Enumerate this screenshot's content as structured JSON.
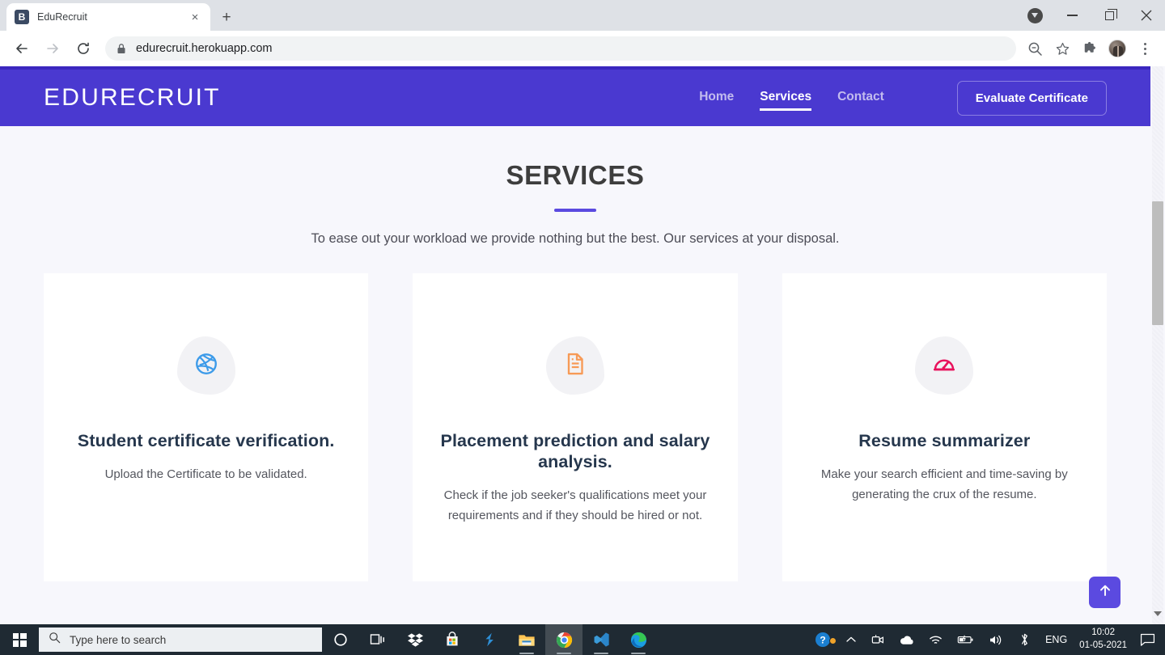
{
  "browser": {
    "tab": {
      "title": "EduRecruit",
      "favicon_letter": "B",
      "favicon_name": "bootstrap-favicon",
      "close_label": "×"
    },
    "new_tab_label": "+",
    "omnibox": {
      "url": "edurecruit.herokuapp.com",
      "lock_icon": "lock-icon"
    },
    "toolbar_icons": [
      "back-arrow-icon",
      "forward-arrow-icon",
      "reload-icon",
      "zoom-out-icon",
      "bookmark-star-icon",
      "extensions-puzzle-icon",
      "profile-avatar",
      "chrome-menu-kebab-icon"
    ],
    "window_controls": [
      "downloads-icon",
      "minimize-button",
      "restore-button",
      "close-button"
    ]
  },
  "site": {
    "logo": "EDURECRUIT",
    "nav": [
      {
        "label": "Home",
        "active": false
      },
      {
        "label": "Services",
        "active": true
      },
      {
        "label": "Contact",
        "active": false
      }
    ],
    "cta_label": "Evaluate Certificate",
    "colors": {
      "header_purple": "#4a39d0",
      "header_top_stripe": "#3b27bf",
      "accent_purple": "#5b4ae0",
      "page_background": "#f7f7fc",
      "card_background": "#ffffff",
      "title_navy": "#26374d"
    }
  },
  "main": {
    "heading": "SERVICES",
    "lede": "To ease out your workload we provide nothing but the best. Our services at your disposal.",
    "cards": [
      {
        "icon": "dribbble-basketball-icon",
        "icon_color": "#3d9be9",
        "title": "Student certificate verification.",
        "desc": "Upload the Certificate to be validated."
      },
      {
        "icon": "document-lines-icon",
        "icon_color": "#f79a56",
        "title": "Placement prediction and salary analysis.",
        "desc": "Check if the job seeker's qualifications meet your requirements and if they should be hired or not."
      },
      {
        "icon": "speedometer-gauge-icon",
        "icon_color": "#e8125c",
        "title": "Resume summarizer",
        "desc": "Make your search efficient and time-saving by generating the crux of the resume."
      }
    ],
    "scroll_to_top": {
      "icon": "arrow-up-icon",
      "label": "↑"
    }
  },
  "taskbar": {
    "start_icon": "windows-start-icon",
    "search_placeholder": "Type here to search",
    "items": [
      "cortana-circle-icon",
      "task-view-icon",
      "dropbox-icon",
      "microsoft-store-icon",
      "sublime-text-icon",
      "file-explorer-icon",
      "google-chrome-icon",
      "vs-code-icon",
      "microsoft-edge-icon"
    ],
    "tray": [
      "help-question-icon",
      "show-hidden-icons-chevron",
      "webcam-icon",
      "onedrive-cloud-icon",
      "wifi-icon",
      "battery-icon",
      "volume-icon",
      "bluetooth-icon"
    ],
    "language": "ENG",
    "time": "10:02",
    "date": "01-05-2021",
    "action_center_icon": "notifications-icon"
  }
}
